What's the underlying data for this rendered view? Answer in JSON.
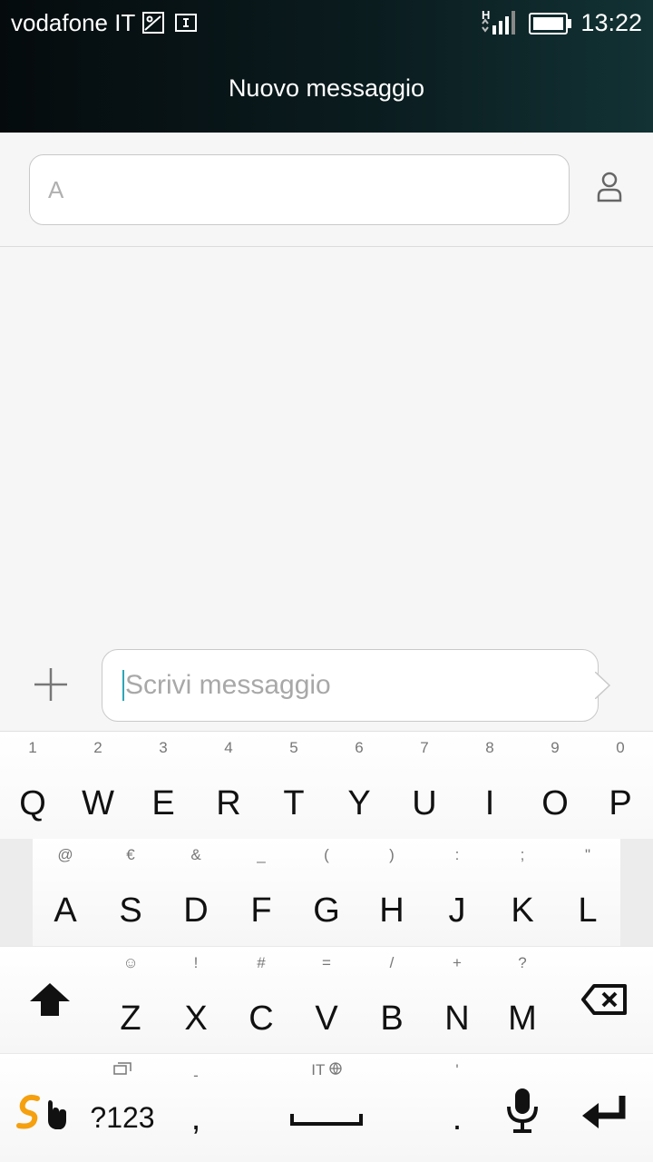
{
  "status_bar": {
    "carrier": "vodafone IT",
    "time": "13:22",
    "network_type": "H",
    "icons": [
      "image-notification-icon",
      "sim-notification-icon",
      "signal-icon",
      "battery-icon"
    ]
  },
  "header": {
    "title": "Nuovo messaggio"
  },
  "recipient": {
    "placeholder": "A"
  },
  "compose": {
    "placeholder": "Scrivi messaggio"
  },
  "keyboard": {
    "row1": [
      {
        "hint": "1",
        "key": "Q"
      },
      {
        "hint": "2",
        "key": "W"
      },
      {
        "hint": "3",
        "key": "E"
      },
      {
        "hint": "4",
        "key": "R"
      },
      {
        "hint": "5",
        "key": "T"
      },
      {
        "hint": "6",
        "key": "Y"
      },
      {
        "hint": "7",
        "key": "U"
      },
      {
        "hint": "8",
        "key": "I"
      },
      {
        "hint": "9",
        "key": "O"
      },
      {
        "hint": "0",
        "key": "P"
      }
    ],
    "row2": [
      {
        "hint": "@",
        "key": "A"
      },
      {
        "hint": "€",
        "key": "S"
      },
      {
        "hint": "&",
        "key": "D"
      },
      {
        "hint": "_",
        "key": "F"
      },
      {
        "hint": "(",
        "key": "G"
      },
      {
        "hint": ")",
        "key": "H"
      },
      {
        "hint": ":",
        "key": "J"
      },
      {
        "hint": ";",
        "key": "K"
      },
      {
        "hint": "\"",
        "key": "L"
      }
    ],
    "row3": [
      {
        "hint": "☺",
        "key": "Z"
      },
      {
        "hint": "!",
        "key": "X"
      },
      {
        "hint": "#",
        "key": "C"
      },
      {
        "hint": "=",
        "key": "V"
      },
      {
        "hint": "/",
        "key": "B"
      },
      {
        "hint": "+",
        "key": "N"
      },
      {
        "hint": "?",
        "key": "M"
      }
    ],
    "row4": {
      "symbols_label": "?123",
      "comma_hint": "-",
      "comma": ",",
      "language_hint": "IT",
      "period_hint": "'",
      "period": "."
    }
  }
}
